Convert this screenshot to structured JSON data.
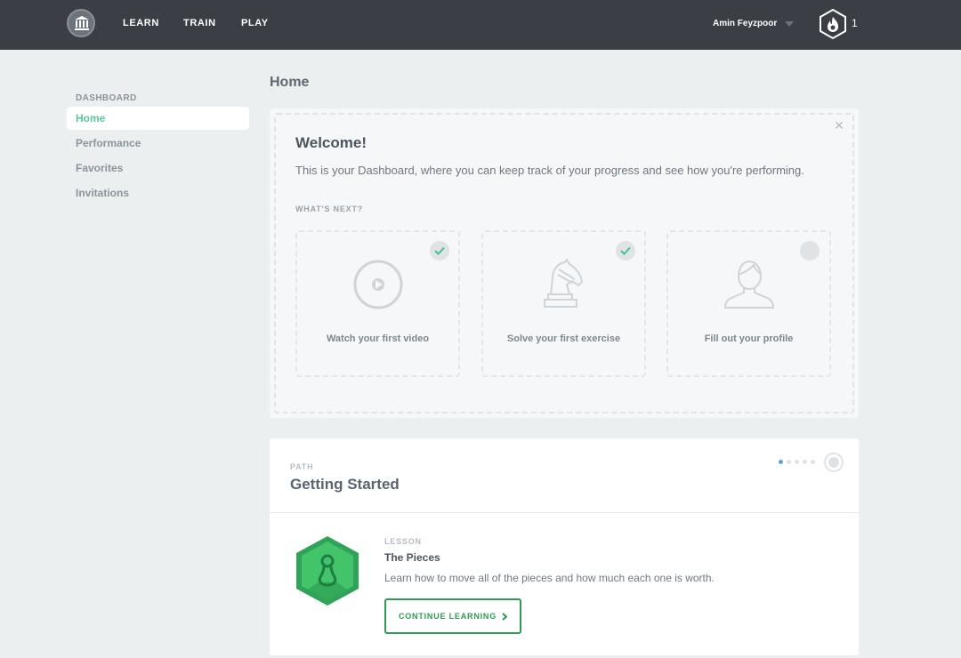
{
  "header": {
    "nav": [
      {
        "label": "LEARN"
      },
      {
        "label": "TRAIN"
      },
      {
        "label": "PLAY"
      }
    ],
    "user_name": "Amin Feyzpoor",
    "streak_count": "1"
  },
  "sidebar": {
    "heading": "DASHBOARD",
    "items": [
      {
        "label": "Home",
        "active": true
      },
      {
        "label": "Performance",
        "active": false
      },
      {
        "label": "Favorites",
        "active": false
      },
      {
        "label": "Invitations",
        "active": false
      }
    ]
  },
  "main": {
    "page_title": "Home",
    "welcome": {
      "title": "Welcome!",
      "subtitle": "This is your Dashboard, where you can keep track of your progress and see how you're performing.",
      "next_heading": "WHAT'S NEXT?",
      "steps": [
        {
          "label": "Watch your first video",
          "icon": "play-icon",
          "completed": true
        },
        {
          "label": "Solve your first exercise",
          "icon": "chess-knight-icon",
          "completed": true
        },
        {
          "label": "Fill out your profile",
          "icon": "user-profile-icon",
          "completed": false
        }
      ]
    },
    "path": {
      "label": "PATH",
      "title": "Getting Started",
      "pager": {
        "current": 1,
        "total": 5
      },
      "lesson": {
        "label": "LESSON",
        "title": "The Pieces",
        "description": "Learn how to move all of the pieces and how much each one is worth.",
        "button_label": "CONTINUE LEARNING"
      }
    }
  },
  "colors": {
    "topbar": "#3b3f45",
    "accent_green": "#5cc899",
    "button_green": "#2e9a55",
    "lesson_hex": "#2fa458",
    "pager_active": "#5aa7cf"
  }
}
